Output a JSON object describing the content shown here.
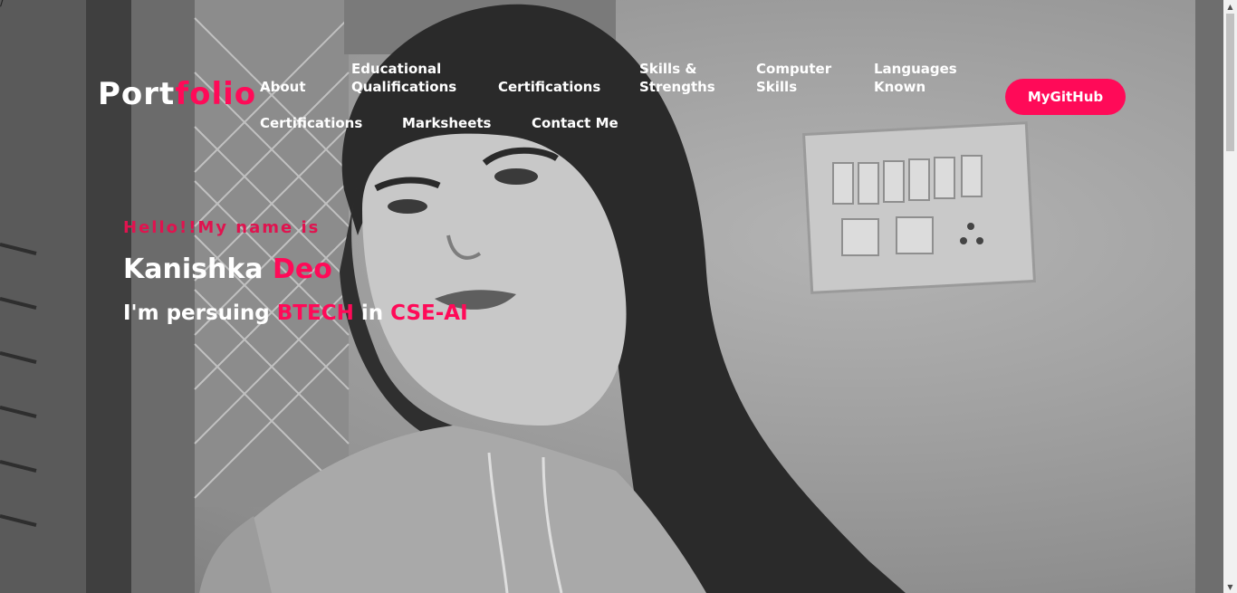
{
  "stray_char": "/",
  "header": {
    "logo_part1": "Port",
    "logo_part2": "folio",
    "nav": {
      "about": "About",
      "educational_line1": "Educational",
      "educational_line2": "Qualifications",
      "certifications_top": "Certifications",
      "skills_line1": "Skills &",
      "skills_line2": "Strengths",
      "computer_line1": "Computer",
      "computer_line2": "Skills",
      "languages_line1": "Languages",
      "languages_line2": "Known",
      "certifications_bottom": "Certifications",
      "marksheets": "Marksheets",
      "contact": "Contact Me"
    },
    "github_label": "MyGitHub"
  },
  "hero": {
    "hello": "Hello!!My name is",
    "first_name": "Kanishka",
    "last_name": "Deo",
    "persuing_prefix": "I'm persuing",
    "degree": "BTECH",
    "in_word": "in",
    "branch": "CSE-AI"
  },
  "colors": {
    "accent": "#ff0a58",
    "text": "#ffffff"
  }
}
